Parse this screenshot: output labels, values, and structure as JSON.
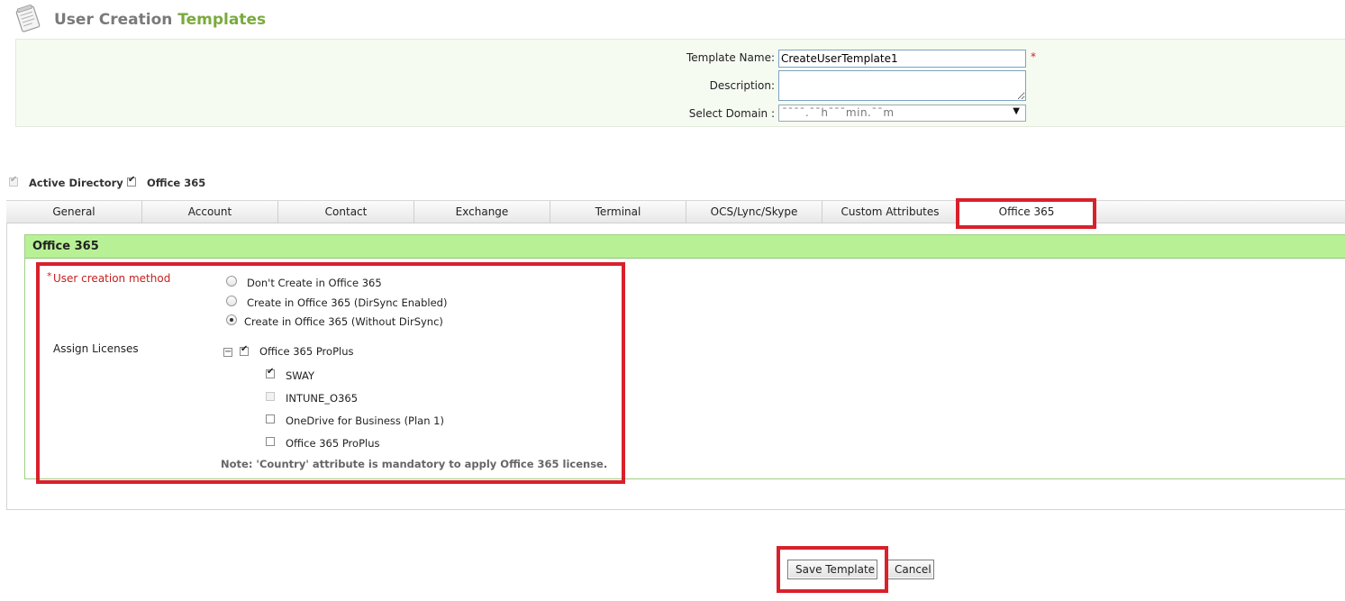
{
  "header": {
    "title_main": "User Creation",
    "title_accent": "Templates",
    "icon": "notepad-icon"
  },
  "form": {
    "template_name_label": "Template Name:",
    "template_name_value": "CreateUserTemplate1",
    "required_mark": "*",
    "description_label": "Description:",
    "description_value": "",
    "domain_label": "Select Domain :",
    "domain_value": "ˉˉˉˉ.ˉˉhˉˉˉmin.ˉˉm"
  },
  "products": [
    {
      "label": "Active Directory",
      "checked": true,
      "disabled": true
    },
    {
      "label": "Office 365",
      "checked": true,
      "disabled": false
    }
  ],
  "tabs": [
    {
      "label": "General"
    },
    {
      "label": "Account"
    },
    {
      "label": "Contact"
    },
    {
      "label": "Exchange"
    },
    {
      "label": "Terminal"
    },
    {
      "label": "OCS/Lync/Skype"
    },
    {
      "label": "Custom Attributes"
    },
    {
      "label": "Office 365",
      "active": true
    }
  ],
  "section": {
    "title": "Office 365",
    "creation_method": {
      "required_mark": "*",
      "label": "User creation method",
      "options": [
        {
          "label": "Don't Create in Office 365",
          "selected": false
        },
        {
          "label": "Create in Office 365 (DirSync Enabled)",
          "selected": false
        },
        {
          "label": "Create in Office 365 (Without DirSync)",
          "selected": true
        }
      ]
    },
    "licenses": {
      "label": "Assign Licenses",
      "group": {
        "label": "Office 365 ProPlus",
        "checked": true,
        "expanded": true,
        "toggle": "⊟"
      },
      "items": [
        {
          "label": "SWAY",
          "checked": true,
          "disabled": false
        },
        {
          "label": "INTUNE_O365",
          "checked": false,
          "disabled": true
        },
        {
          "label": "OneDrive for Business (Plan 1)",
          "checked": false,
          "disabled": false
        },
        {
          "label": "Office 365 ProPlus",
          "checked": false,
          "disabled": false
        }
      ]
    },
    "note": "Note: 'Country' attribute is mandatory to apply Office 365 license."
  },
  "actions": {
    "save_label": "Save Template",
    "cancel_label": "Cancel"
  },
  "colors": {
    "highlight_frame": "#d8212b",
    "section_header": "#b8f195",
    "title_accent": "#7aaa3e",
    "required": "#c81e1e"
  }
}
